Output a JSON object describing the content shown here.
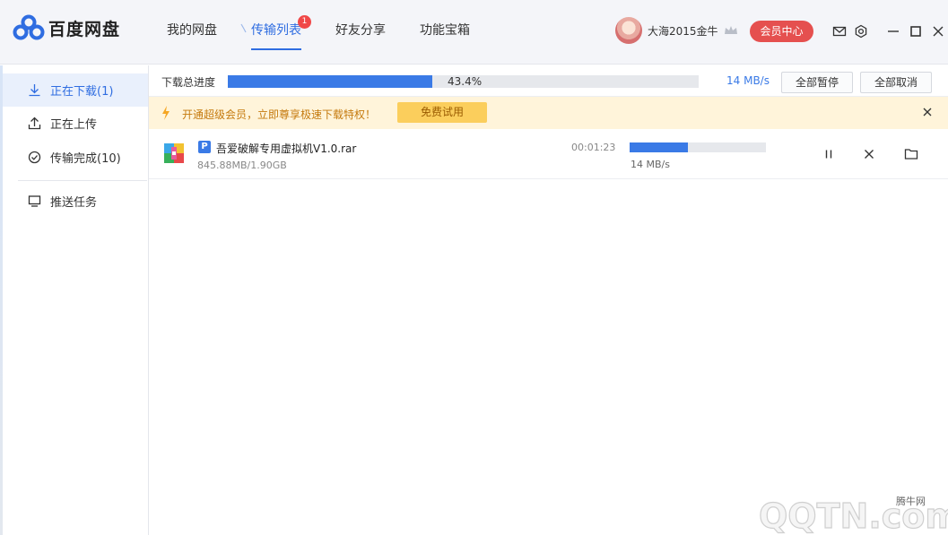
{
  "app": {
    "name": "百度网盘"
  },
  "nav": {
    "items": [
      {
        "label": "我的网盘"
      },
      {
        "label": "传输列表",
        "badge": "1"
      },
      {
        "label": "好友分享"
      },
      {
        "label": "功能宝箱"
      }
    ]
  },
  "user": {
    "name": "大海2015金牛",
    "vip_button": "会员中心"
  },
  "sidebar": {
    "items": [
      {
        "label": "正在下载(1)",
        "icon": "download-icon"
      },
      {
        "label": "正在上传",
        "icon": "upload-icon"
      },
      {
        "label": "传输完成(10)",
        "icon": "check-circle-icon"
      },
      {
        "label": "推送任务",
        "icon": "monitor-icon"
      }
    ]
  },
  "overall": {
    "label": "下载总进度",
    "progress": 0.434,
    "percent_text": "43.4%",
    "speed": "14 MB/s",
    "pause_all": "全部暂停",
    "cancel_all": "全部取消"
  },
  "promo": {
    "text": "开通超级会员，立即尊享极速下载特权！",
    "button": "免费试用"
  },
  "downloads": [
    {
      "name": "吾爱破解专用虚拟机V1.0.rar",
      "size": "845.88MB/1.90GB",
      "time_left": "00:01:23",
      "progress": 0.43,
      "speed": "14 MB/s"
    }
  ],
  "watermark": {
    "site": "QQTN.com",
    "label": "腾牛网"
  },
  "colors": {
    "accent": "#3a7ae6",
    "vip": "#e5504f",
    "promo_bg": "#fff4da"
  }
}
